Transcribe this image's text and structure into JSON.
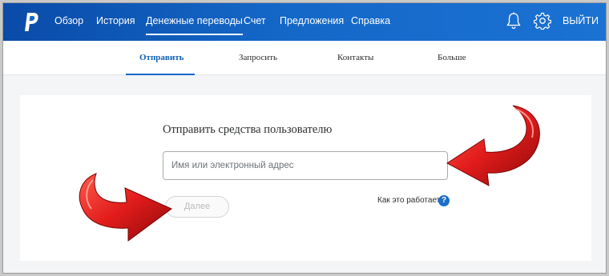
{
  "nav": {
    "items": [
      "Обзор",
      "История",
      "Денежные переводы",
      "Счет",
      "Предложения",
      "Справка"
    ],
    "active": "Денежные переводы",
    "logout": "ВЫЙТИ"
  },
  "subnav": {
    "items": [
      "Отправить",
      "Запросить",
      "Контакты",
      "Больше"
    ],
    "active": "Отправить"
  },
  "send": {
    "heading": "Отправить средства пользователю",
    "placeholder": "Имя или электронный адрес",
    "next_label": "Далее",
    "how_it_works": "Как это работает",
    "help_glyph": "?"
  },
  "icons": {
    "logo": "paypal-logo-icon",
    "bell": "bell-icon",
    "gear": "gear-icon",
    "help": "question-icon",
    "arrow_right": "red-arrow-icon",
    "arrow_left": "red-arrow-icon"
  },
  "colors": {
    "nav_bg": "#1467c7",
    "accent": "#0f5fb5",
    "arrow": "#e11b1b",
    "help_badge": "#1a6fc9"
  }
}
